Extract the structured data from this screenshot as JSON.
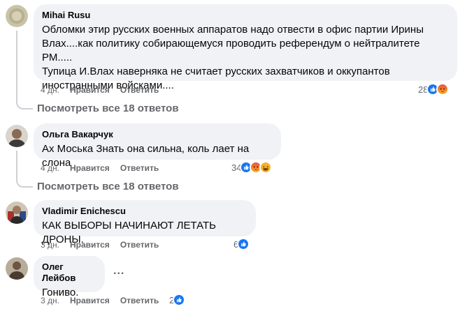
{
  "comments": [
    {
      "author": "Mihai Rusu",
      "text": "Обломки этир русских военных аппаратов надо отвести в офис партии Ирины\nВлах....как политику собирающемуся проводить референдум о нейтралитете РМ.....\nТупица И.Влах наверняка не считает русских захватчиков и оккупантов\nиностранными войсками....",
      "time": "4 дн.",
      "like": "Нравится",
      "reply": "Ответить",
      "reactions_count": "28",
      "reactions": [
        "like-icon",
        "angry-icon"
      ],
      "view_replies": "Посмотреть все 18 ответов"
    },
    {
      "author": "Ольга Вакарчук",
      "text": "Ах Моська Знать она сильна, коль лает на слона",
      "time": "4 дн.",
      "like": "Нравится",
      "reply": "Ответить",
      "reactions_count": "34",
      "reactions": [
        "like-icon",
        "angry-icon",
        "haha-icon"
      ],
      "view_replies": "Посмотреть все 18 ответов"
    },
    {
      "author": "Vladimir Enichescu",
      "text": "КАК ВЫБОРЫ НАЧИНАЮТ ЛЕТАТЬ ДРОНЫ.",
      "time": "3 дн.",
      "like": "Нравится",
      "reply": "Ответить",
      "reactions_count": "6",
      "reactions": [
        "like-icon"
      ]
    },
    {
      "author": "Олег Лейбов",
      "text": "Гониво.",
      "time": "3 дн.",
      "like": "Нравится",
      "reply": "Ответить",
      "reactions_count": "2",
      "reactions": [
        "like-icon"
      ],
      "more": "..."
    }
  ],
  "colors": {
    "like": "#1877f2",
    "angry": "#e9710f",
    "haha": "#f7b125",
    "bubble": "#f0f2f5",
    "meta": "#65676b"
  }
}
